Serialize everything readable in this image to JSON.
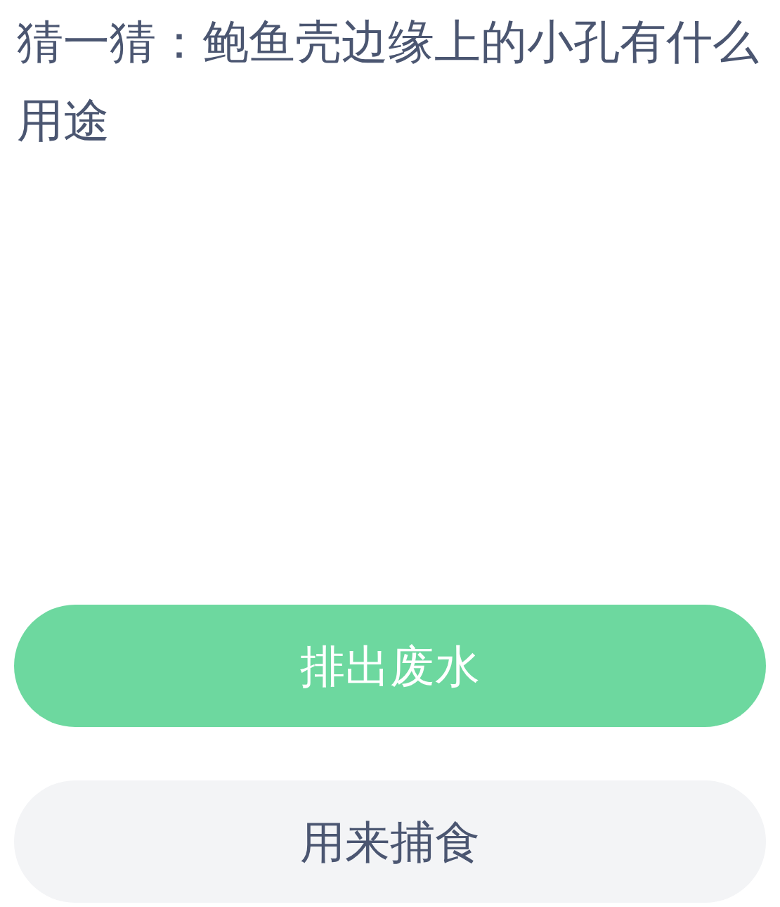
{
  "question": "猜一猜：鲍鱼壳边缘上的小孔有什么用途",
  "options": [
    {
      "label": "排出废水",
      "selected": true
    },
    {
      "label": "用来捕食",
      "selected": false
    }
  ]
}
